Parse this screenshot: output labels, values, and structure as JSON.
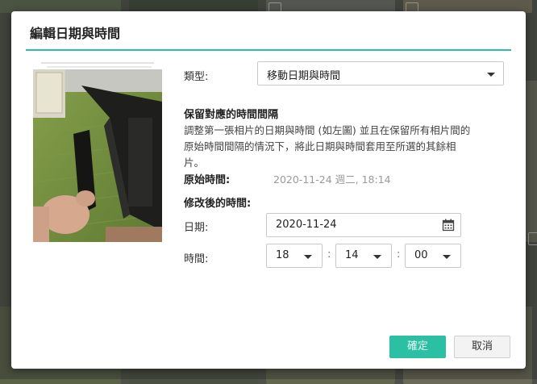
{
  "dialog": {
    "title": "編輯日期與時間",
    "type_label": "類型:",
    "type_value": "移動日期與時間",
    "section_heading": "保留對應的時間間隔",
    "description": "調整第一張相片的日期與時間 (如左圖) 並且在保留所有相片間的原始時間間隔的情況下，將此日期與時間套用至所選的其餘相片。",
    "original_label": "原始時間:",
    "original_value": "2020-11-24 週二, 18:14",
    "modified_label": "修改後的時間:",
    "date_label": "日期:",
    "date_value": "2020-11-24",
    "time_label": "時間:",
    "hour": "18",
    "minute": "14",
    "second": "00",
    "colon": ":",
    "ok_label": "確定",
    "cancel_label": "取消"
  },
  "colors": {
    "accent": "#2bbfa3",
    "backdrop": "#4d5148"
  },
  "icons": {
    "dropdown": "caret-down-icon",
    "calendar": "calendar-icon"
  }
}
